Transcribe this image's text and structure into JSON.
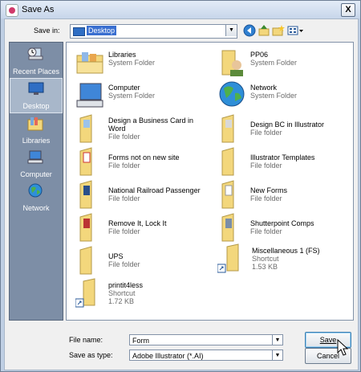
{
  "window": {
    "title": "Save As",
    "close_glyph": "X"
  },
  "toolbar": {
    "save_in_label": "Save in:",
    "save_in_value": "Desktop",
    "icons": [
      "back-icon",
      "up-folder-icon",
      "new-folder-icon",
      "views-menu-icon"
    ]
  },
  "places": [
    {
      "label": "Recent Places",
      "icon": "recent-places-icon",
      "selected": false
    },
    {
      "label": "Desktop",
      "icon": "desktop-icon",
      "selected": true
    },
    {
      "label": "Libraries",
      "icon": "libraries-icon",
      "selected": false
    },
    {
      "label": "Computer",
      "icon": "computer-icon",
      "selected": false
    },
    {
      "label": "Network",
      "icon": "network-icon",
      "selected": false
    }
  ],
  "files": [
    {
      "name": "Libraries",
      "type": "System Folder",
      "icon": "libraries-folder-icon"
    },
    {
      "name": "PP06",
      "type": "System Folder",
      "icon": "user-folder-icon"
    },
    {
      "name": "Computer",
      "type": "System Folder",
      "icon": "computer-icon"
    },
    {
      "name": "Network",
      "type": "System Folder",
      "icon": "network-icon"
    },
    {
      "name": "Design a Business Card in Word",
      "type": "File folder",
      "icon": "folder-icon"
    },
    {
      "name": "Design BC in Illustrator",
      "type": "File folder",
      "icon": "folder-icon"
    },
    {
      "name": "Forms not on new site",
      "type": "File folder",
      "icon": "folder-icon"
    },
    {
      "name": "Illustrator Templates",
      "type": "File folder",
      "icon": "folder-icon"
    },
    {
      "name": "National Railroad Passenger",
      "type": "File folder",
      "icon": "folder-icon"
    },
    {
      "name": "New Forms",
      "type": "File folder",
      "icon": "folder-icon"
    },
    {
      "name": "Remove It, Lock It",
      "type": "File folder",
      "icon": "folder-icon"
    },
    {
      "name": "Shutterpoint Comps",
      "type": "File folder",
      "icon": "folder-icon"
    },
    {
      "name": "UPS",
      "type": "File folder",
      "icon": "folder-icon"
    },
    {
      "name": "Miscellaneous 1 (FS)",
      "type": "Shortcut",
      "size": "1.53 KB",
      "icon": "folder-shortcut-icon"
    },
    {
      "name": "printit4less",
      "type": "Shortcut",
      "size": "1.72 KB",
      "icon": "folder-shortcut-icon"
    }
  ],
  "footer": {
    "file_name_label": "File name:",
    "file_name_value": "Form",
    "save_type_label": "Save as type:",
    "save_type_value": "Adobe Illustrator (*.AI)",
    "save_button": "Save",
    "cancel_button": "Cancel"
  },
  "colors": {
    "places_bg": "#7d8ea6",
    "selection_blue": "#3a6fd0",
    "folder_yellow": "#f3d77c",
    "window_frame": "#bfcfe4"
  }
}
